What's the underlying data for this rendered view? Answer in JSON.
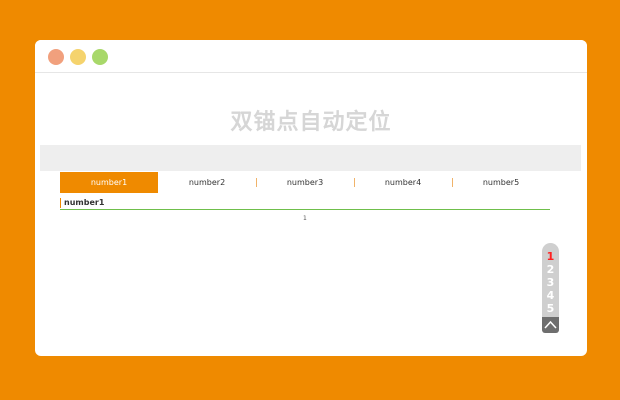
{
  "colors": {
    "background": "#ef8a00",
    "accent": "#ef8a00",
    "divider": "#6fbf4b",
    "active_anchor": "#ff2020"
  },
  "window": {
    "controls": [
      "close-dot",
      "minimize-dot",
      "maximize-dot"
    ]
  },
  "page": {
    "title": "双锚点自动定位"
  },
  "tabs": [
    {
      "label": "number1",
      "active": true
    },
    {
      "label": "number2",
      "active": false
    },
    {
      "label": "number3",
      "active": false
    },
    {
      "label": "number4",
      "active": false
    },
    {
      "label": "number5",
      "active": false
    }
  ],
  "section": {
    "label": "number1",
    "marker": "1"
  },
  "anchors": [
    {
      "label": "1",
      "active": true
    },
    {
      "label": "2",
      "active": false
    },
    {
      "label": "3",
      "active": false
    },
    {
      "label": "4",
      "active": false
    },
    {
      "label": "5",
      "active": false
    }
  ],
  "back_to_top_icon": "chevron-up-icon"
}
